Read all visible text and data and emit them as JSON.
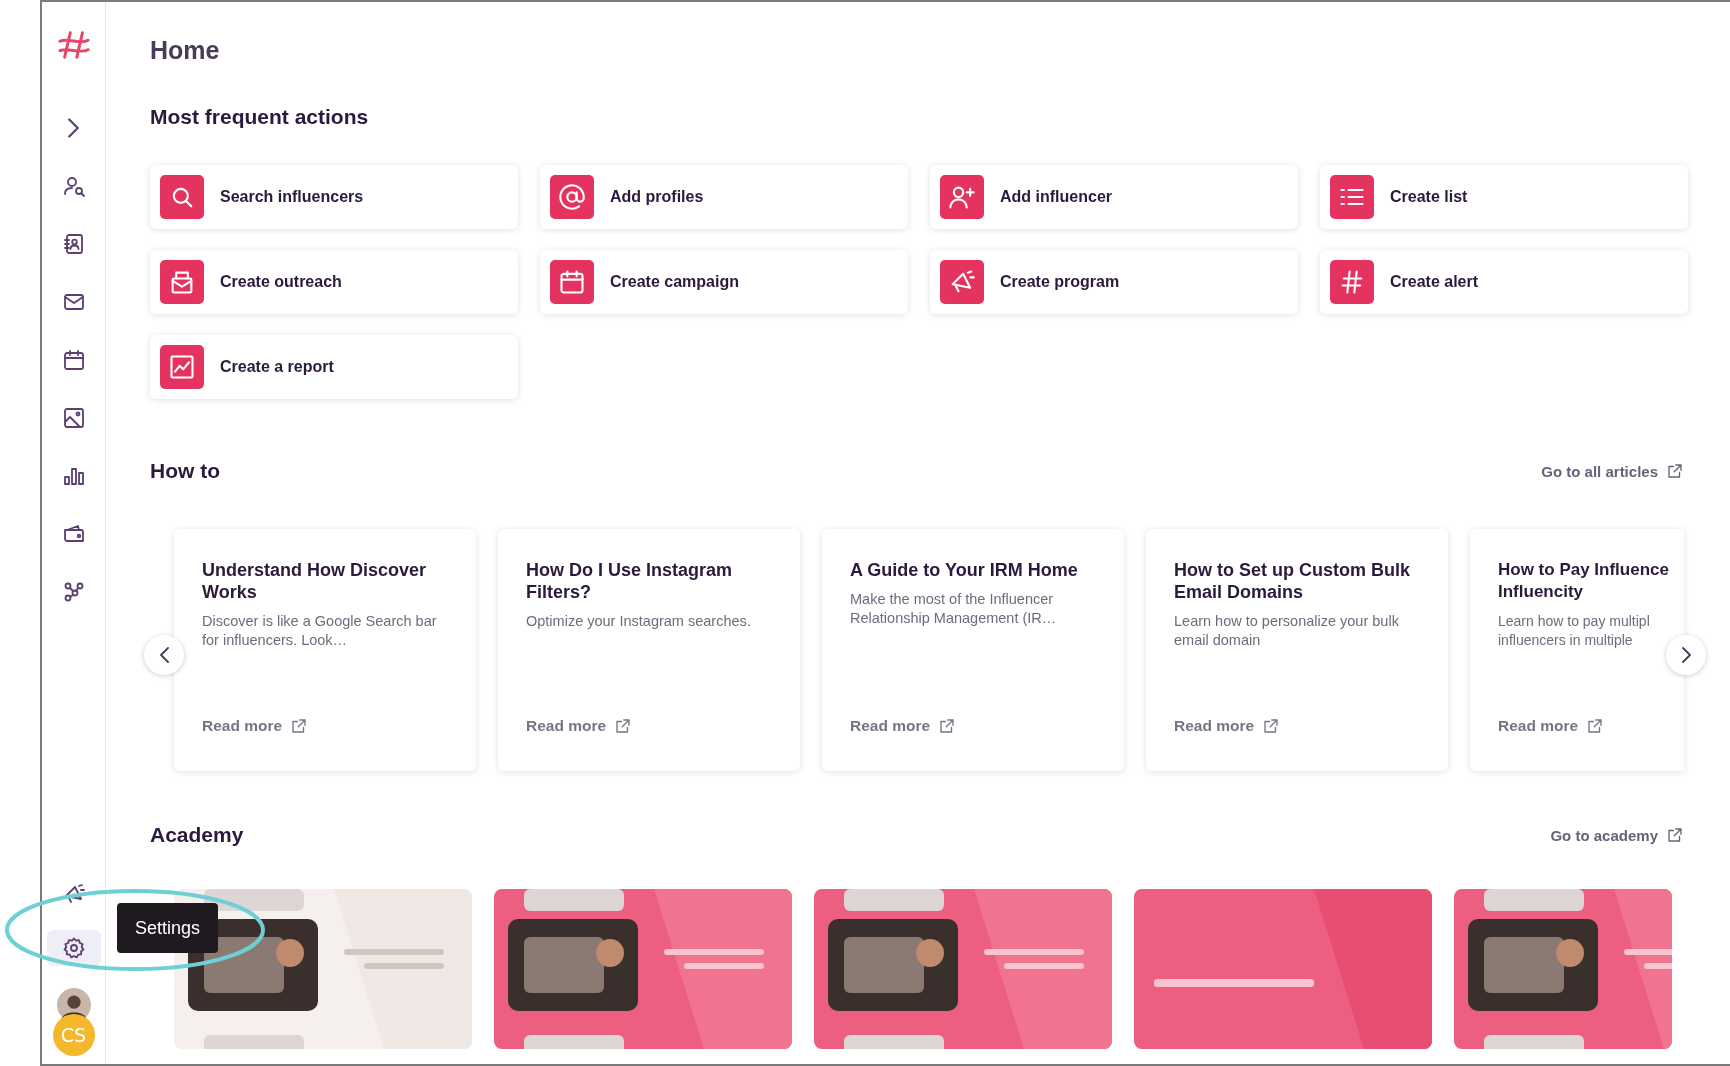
{
  "sidebar": {
    "items": [
      {
        "kind": "expand",
        "selected": false
      },
      {
        "kind": "profiles",
        "selected": false
      },
      {
        "kind": "contacts",
        "selected": false
      },
      {
        "kind": "mail",
        "selected": false
      },
      {
        "kind": "calendar",
        "selected": false
      },
      {
        "kind": "gallery",
        "selected": false
      },
      {
        "kind": "stats",
        "selected": false
      },
      {
        "kind": "wallet",
        "selected": false
      },
      {
        "kind": "network",
        "selected": false
      }
    ],
    "bottom_items": [
      {
        "kind": "megaphone",
        "selected": false
      },
      {
        "kind": "settings",
        "selected": true
      }
    ],
    "avatar_initials": "CS"
  },
  "tooltip": {
    "text": "Settings"
  },
  "page_title": "Home",
  "actions": {
    "title": "Most frequent actions",
    "items": [
      {
        "label": "Search influencers",
        "kind": "search"
      },
      {
        "label": "Add profiles",
        "kind": "at"
      },
      {
        "label": "Add influencer",
        "kind": "adduser"
      },
      {
        "label": "Create list",
        "kind": "list"
      },
      {
        "label": "Create outreach",
        "kind": "outreach"
      },
      {
        "label": "Create campaign",
        "kind": "calendar"
      },
      {
        "label": "Create program",
        "kind": "megaphone"
      },
      {
        "label": "Create alert",
        "kind": "hash"
      },
      {
        "label": "Create a report",
        "kind": "chart"
      }
    ]
  },
  "how_to": {
    "title": "How to",
    "link": "Go to all articles",
    "articles": [
      {
        "title": "Understand How Discover Works",
        "summary": "Discover is like a Google Search bar for influencers. Look…",
        "link": "Read more"
      },
      {
        "title": "How Do I Use Instagram Filters?",
        "summary": "Optimize your Instagram searches.",
        "link": "Read more"
      },
      {
        "title": "A Guide to Your IRM Home",
        "summary": "Make the most of the Influencer Relationship Management (IR…",
        "link": "Read more"
      },
      {
        "title": "How to Set up Custom Bulk Email Domains",
        "summary": "Learn how to personalize your bulk email domain",
        "link": "Read more"
      },
      {
        "title": "How to Pay Influence Influencity",
        "summary": "Learn how to pay multipl influencers in multiple",
        "link": "Read more"
      }
    ]
  },
  "academy": {
    "title": "Academy",
    "link": "Go to academy"
  }
}
